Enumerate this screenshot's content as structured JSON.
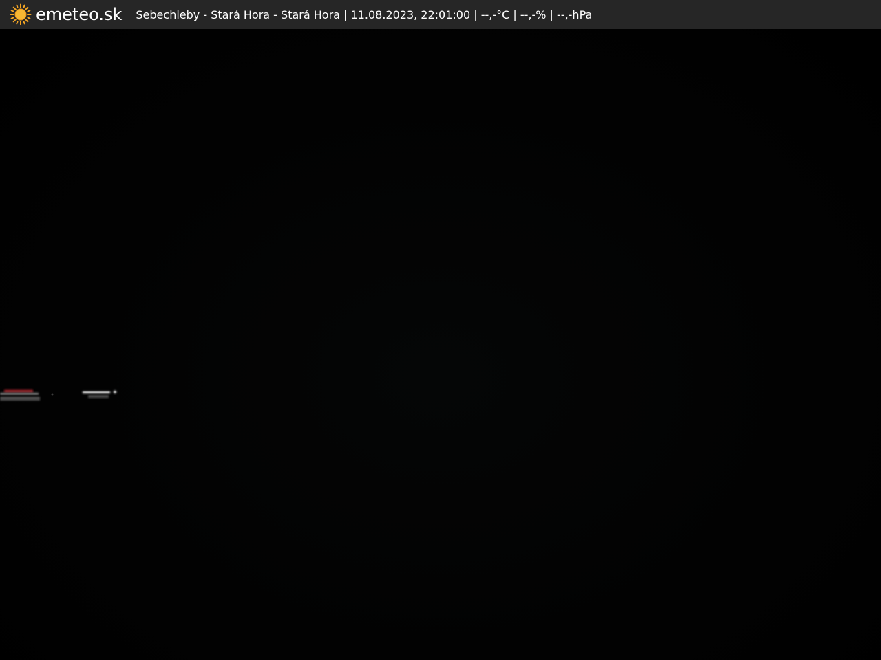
{
  "header": {
    "brand": "emeteo.sk",
    "caption": "Sebechleby - Stará Hora - Stará Hora | 11.08.2023, 22:01:00 | --,-°C | --,-% | --,-hPa",
    "logo_icon": "sun-icon",
    "logo_color": "#f5a623",
    "background_color": "#262626"
  },
  "image": {
    "description_colors": {
      "sky": "#020202",
      "headlight": "#ffffff",
      "taillight": "#e0303a"
    }
  }
}
